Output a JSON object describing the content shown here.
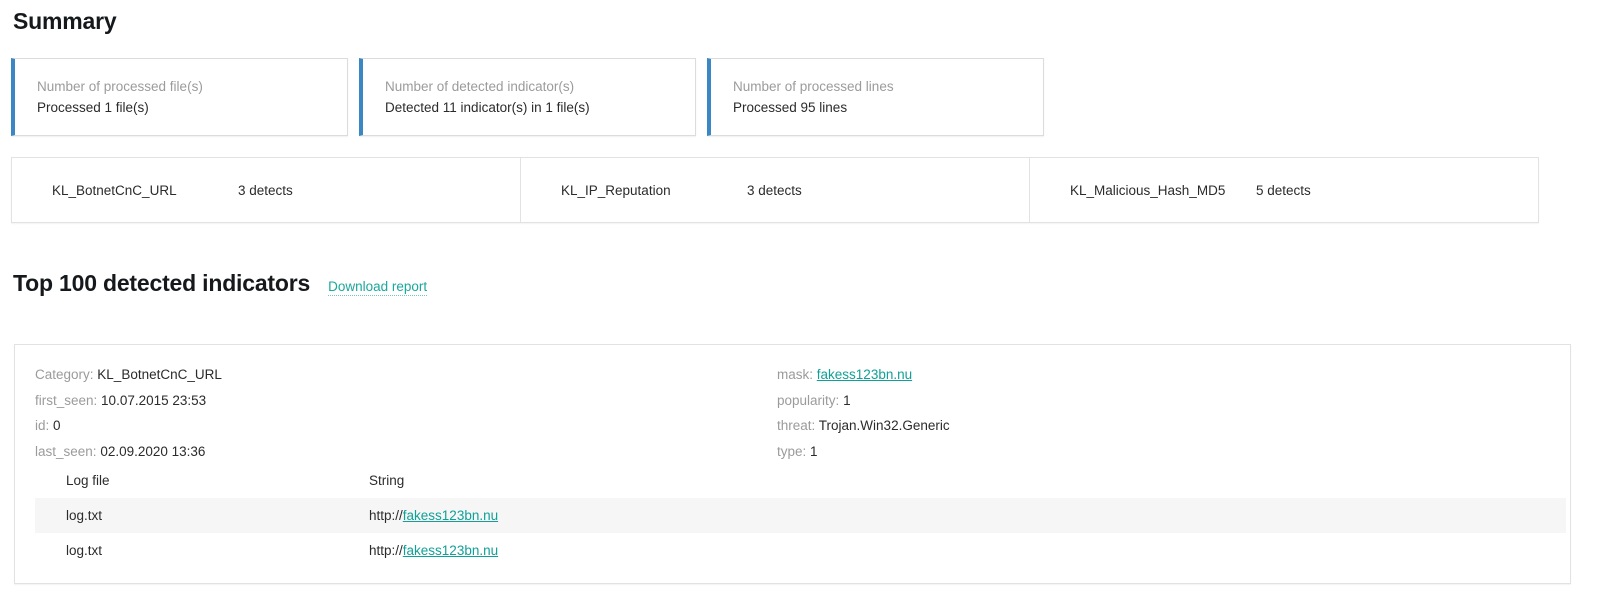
{
  "page": {
    "title": "Summary"
  },
  "summary_cards": [
    {
      "label": "Number of processed file(s)",
      "value": "Processed 1 file(s)",
      "accent": "#3b87c3"
    },
    {
      "label": "Number of detected indicator(s)",
      "value": "Detected 11 indicator(s) in 1 file(s)",
      "accent": "#3b87c3"
    },
    {
      "label": "Number of processed lines",
      "value": "Processed 95 lines",
      "accent": "#3b87c3"
    }
  ],
  "detects": [
    {
      "category": "KL_BotnetCnC_URL",
      "count": "3 detects"
    },
    {
      "category": "KL_IP_Reputation",
      "count": "3 detects"
    },
    {
      "category": "KL_Malicious_Hash_MD5",
      "count": "5 detects"
    }
  ],
  "indicators_section": {
    "title": "Top 100 detected indicators",
    "download_label": "Download report",
    "link_color": "#1aa79e"
  },
  "indicator": {
    "meta_left": [
      {
        "key": "Category:",
        "value": "KL_BotnetCnC_URL"
      },
      {
        "key": "first_seen:",
        "value": "10.07.2015 23:53"
      },
      {
        "key": "id:",
        "value": "0"
      },
      {
        "key": "last_seen:",
        "value": "02.09.2020 13:36"
      }
    ],
    "meta_right": [
      {
        "key": "mask:",
        "value": "fakess123bn.nu",
        "is_link": true
      },
      {
        "key": "popularity:",
        "value": "1"
      },
      {
        "key": "threat:",
        "value": "Trojan.Win32.Generic"
      },
      {
        "key": "type:",
        "value": "1"
      }
    ],
    "table": {
      "columns": [
        "Log file",
        "String"
      ],
      "rows": [
        {
          "log_file": "log.txt",
          "string_prefix": "http://",
          "string_link": "fakess123bn.nu"
        },
        {
          "log_file": "log.txt",
          "string_prefix": "http://",
          "string_link": "fakess123bn.nu"
        }
      ]
    }
  }
}
